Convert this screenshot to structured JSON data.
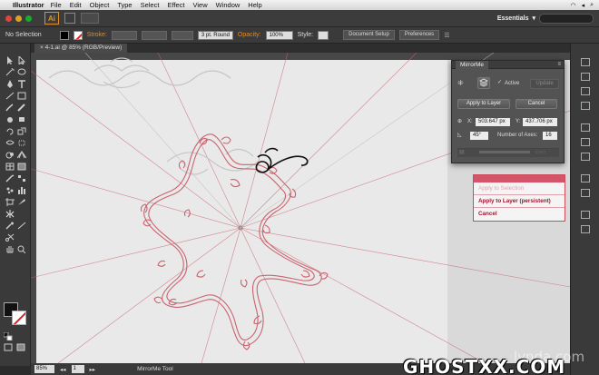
{
  "menubar": {
    "app": "Illustrator",
    "items": [
      "File",
      "Edit",
      "Object",
      "Type",
      "Select",
      "Effect",
      "View",
      "Window",
      "Help"
    ]
  },
  "appbar": {
    "logo": "Ai",
    "workspace": "Essentials"
  },
  "control": {
    "selection": "No Selection",
    "stroke_label": "Stroke:",
    "brush": "3 pt. Round",
    "opacity_label": "Opacity:",
    "opacity_value": "100%",
    "style_label": "Style:",
    "document_setup": "Document Setup",
    "preferences": "Preferences"
  },
  "document": {
    "tab_title": "4-1.ai @ 85% (RGB/Preview)"
  },
  "panel": {
    "title": "MirrorMe",
    "active_label": "Active",
    "update": "Update",
    "apply_to_layer": "Apply to Layer",
    "cancel": "Cancel",
    "x_label": "X:",
    "x_value": "503.647 px",
    "y_label": "Y:",
    "y_value": "437.706 px",
    "angle_value": "45°",
    "axes_label": "Number of Axes:",
    "axes_value": "16"
  },
  "context_menu": {
    "items": [
      "Apply to Selection",
      "Apply to Layer (persistent)",
      "Cancel"
    ]
  },
  "status": {
    "zoom": "85%",
    "page": "1",
    "tool": "MirrorMe Tool"
  },
  "watermark": {
    "lynda": "lynda.com",
    "ghost": "GHOSTXX.COM"
  },
  "colors": {
    "accent_orange": "#e68a1f",
    "mirror_red": "#c9636f",
    "menu_red": "#a4122e"
  }
}
